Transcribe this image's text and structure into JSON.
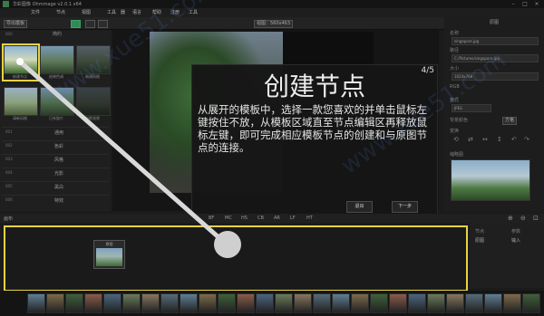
{
  "window": {
    "title": "华彩图像 Ohmmage v2.0.1 x64"
  },
  "menu": [
    "文件",
    "节点",
    "视图",
    "工具",
    "器",
    "语言",
    "帮助",
    "注册",
    "工具"
  ],
  "toolbar": {
    "preset": "导出模板",
    "view": "视图：560x463"
  },
  "templates": {
    "tab": "简约",
    "rows": [
      {
        "id": "001",
        "label": "通用"
      },
      {
        "id": "002",
        "label": "色彩"
      },
      {
        "id": "003",
        "label": "风格"
      },
      {
        "id": "004",
        "label": "光影"
      },
      {
        "id": "005",
        "label": "黑白"
      },
      {
        "id": "006",
        "label": "特效"
      }
    ],
    "thumbs": [
      "新建节点",
      "经典色调",
      "暗调风格",
      "清新风格",
      "日系胶片",
      "电影效果"
    ]
  },
  "tutorial": {
    "title": "创建节点",
    "page": "4/5",
    "body": "从展开的模板中，选择一款您喜欢的并单击鼠标左键按住不放，从模板区域直至节点编辑区再释放鼠标左键，即可完成相应模板节点的创建和与原图节点的连接。",
    "back": "退出",
    "next": "下一步"
  },
  "properties": {
    "header": "原图",
    "name_label": "名称",
    "name_value": "singapore.jpg",
    "path_label": "路径",
    "path_value": "C:/Pictures/singapore.jpg",
    "size_label": "大小",
    "size_value": "1024x768",
    "mode_label": "RGB",
    "format_label": "格式",
    "format_value": "JPEG",
    "bg_label": "背景颜色",
    "bg_value": "方格",
    "transform_label": "变换",
    "preview_label": "缩略图"
  },
  "nodebar": {
    "label": "画布",
    "items": [
      "BF",
      "MC",
      "HS",
      "CB",
      "AR",
      "LF",
      "HT"
    ]
  },
  "node": {
    "label": "原图"
  },
  "node_params": {
    "col1": "节点",
    "col2": "参数",
    "row_l": "原图",
    "row_r": "输入"
  },
  "colors": {
    "highlight": "#e7d244",
    "accent": "#2e8b57"
  }
}
